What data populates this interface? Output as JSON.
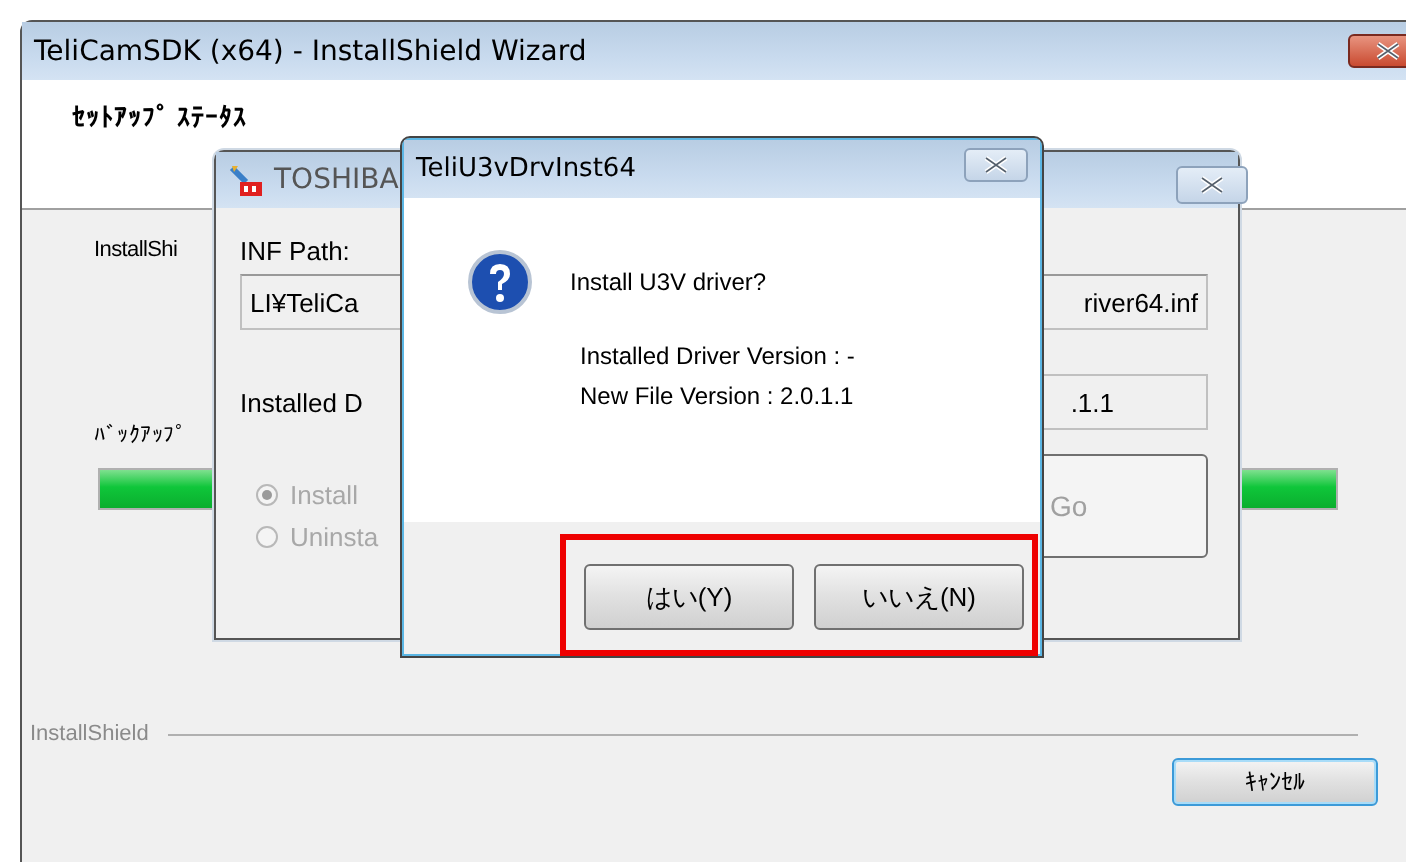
{
  "main_window": {
    "title": "TeliCamSDK (x64) - InstallShield Wizard",
    "heading": "ｾｯﾄｱｯﾌﾟ ｽﾃｰﾀｽ",
    "status_label": "InstallShi",
    "progress_label": "ﾊﾞｯｸｱｯﾌﾟ",
    "progress": {
      "level": 1
    },
    "brand": "InstallShield",
    "buttons": [
      {
        "label": "ｷｬﾝｾﾙ",
        "focused": true
      }
    ]
  },
  "toshiba_window": {
    "title": "TOSHIBA",
    "inf_label": "INF Path:",
    "inf_value_left": "LI¥TeliCa",
    "inf_value_right": "river64.inf",
    "version_label": "Installed D",
    "version_value": ".1.1",
    "options_disabled": true,
    "options": [
      {
        "label": "Install",
        "selected": true
      },
      {
        "label": "Uninsta",
        "selected": false
      }
    ],
    "go_button": {
      "label": "Go",
      "disabled": true
    }
  },
  "dialog": {
    "title": "TeliU3vDrvInst64",
    "question": "Install U3V driver?",
    "details": [
      "Installed Driver Version : -",
      "New File Version : 2.0.1.1"
    ],
    "buttons_highlighted": true,
    "buttons": [
      {
        "label": "はい(Y)"
      },
      {
        "label": "いいえ(N)"
      }
    ]
  }
}
